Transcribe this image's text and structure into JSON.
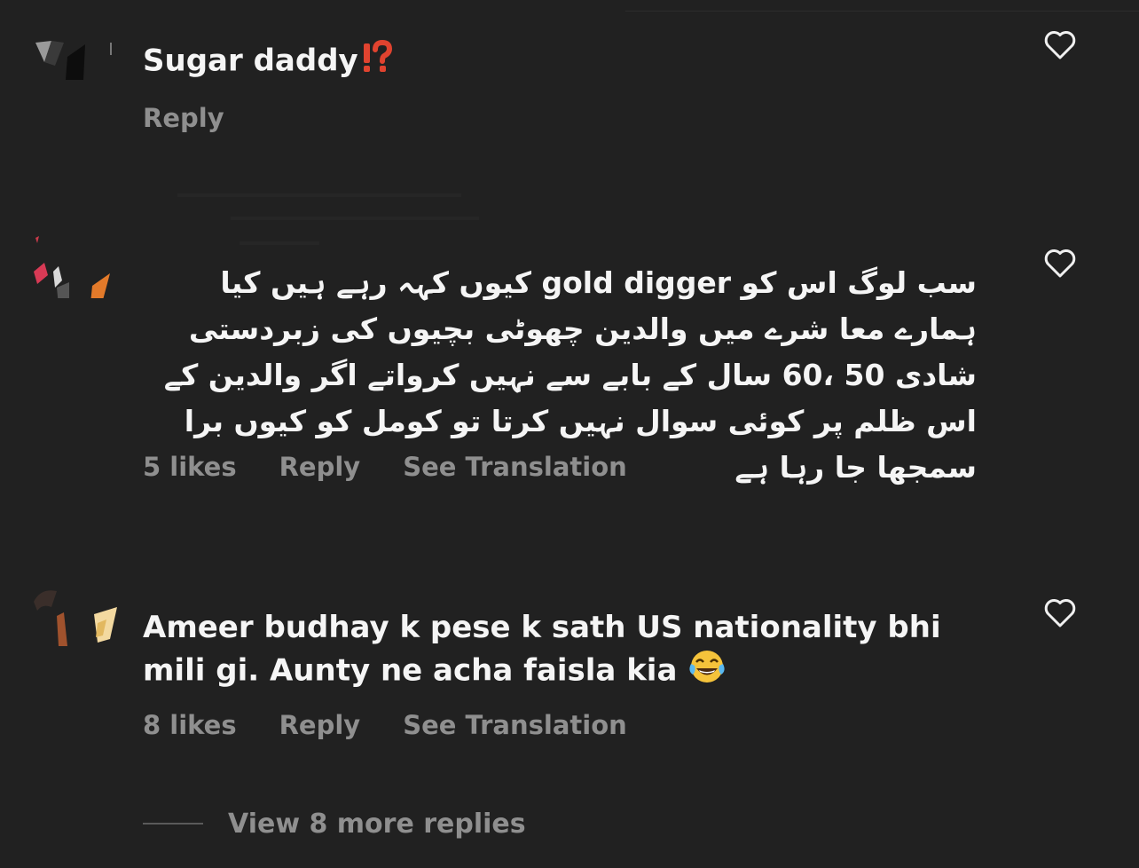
{
  "comments": [
    {
      "text": "Sugar daddy",
      "emoji": "⁉️",
      "likes": "",
      "reply_label": "Reply",
      "translate_label": ""
    },
    {
      "text": "سب لوگ اس کو gold digger کیوں کہہ رہے ہیں کیا ہمارے معا شرے میں والدین چھوٹی بچیوں کی زبردستی  شادی 50 ،60 سال کے بابے سے نہیں کرواتے اگر والدین کے اس ظلم پر کوئی سوال نہیں کرتا تو کومل کو کیوں برا سمجھا جا رہا ہے",
      "likes": "5 likes",
      "reply_label": "Reply",
      "translate_label": "See Translation"
    },
    {
      "text": "Ameer budhay k pese k sath US nationality bhi mili gi. Aunty ne acha faisla kia",
      "emoji": "😂",
      "likes": "8 likes",
      "reply_label": "Reply",
      "translate_label": "See Translation"
    }
  ],
  "view_more": {
    "label": "View 8 more replies"
  },
  "colors": {
    "background": "#212121",
    "text": "#f5f5f5",
    "muted": "#8f8f8f",
    "alert_red": "#e0432f"
  },
  "icons": {
    "like": "heart-outline-icon",
    "laugh": "tears-of-joy-emoji"
  }
}
